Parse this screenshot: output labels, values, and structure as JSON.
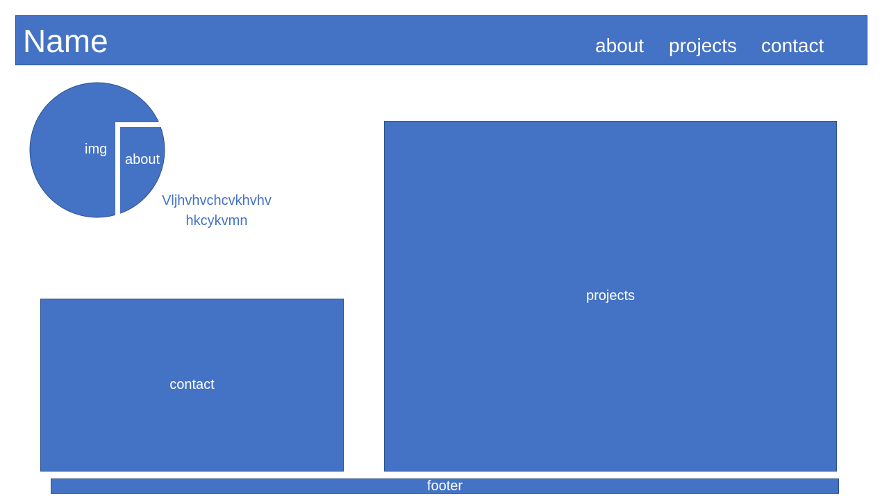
{
  "header": {
    "name": "Name",
    "nav": [
      "about",
      "projects",
      "contact"
    ]
  },
  "profile": {
    "img_label": "img",
    "about_label": "about",
    "glyph": "",
    "about_text_line1": "Vljhvhvchcvkhvhv",
    "about_text_line2": "hkcykvmn"
  },
  "sections": {
    "contact_label": "contact",
    "projects_label": "projects",
    "footer_label": "footer"
  },
  "colors": {
    "accent": "#4472c4",
    "border": "#2f528f",
    "text_light": "#ffffff"
  }
}
